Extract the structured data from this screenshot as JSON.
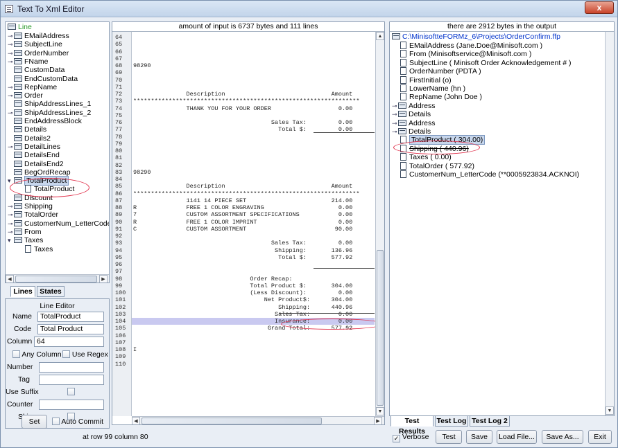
{
  "window": {
    "title": "Text To Xml Editor",
    "close_label": "x"
  },
  "left_tree": {
    "root": "Line",
    "items": [
      {
        "label": "EMailAddress",
        "t": "⊸"
      },
      {
        "label": "SubjectLine",
        "t": "⊸"
      },
      {
        "label": "OrderNumber",
        "t": "⊸"
      },
      {
        "label": "FName",
        "t": "⊸"
      },
      {
        "label": "CustomData",
        "t": ""
      },
      {
        "label": "EndCustomData",
        "t": ""
      },
      {
        "label": "RepName",
        "t": "⊸"
      },
      {
        "label": "Order",
        "t": "⊸"
      },
      {
        "label": "ShipAddressLines_1",
        "t": ""
      },
      {
        "label": "ShipAddressLines_2",
        "t": "⊸"
      },
      {
        "label": "EndAddressBlock",
        "t": ""
      },
      {
        "label": "Details",
        "t": ""
      },
      {
        "label": "Details2",
        "t": ""
      },
      {
        "label": "DetailLines",
        "t": "⊸"
      },
      {
        "label": "DetailsEnd",
        "t": ""
      },
      {
        "label": "DetailsEnd2",
        "t": ""
      },
      {
        "label": "BegOrdRecap",
        "t": ""
      },
      {
        "label": "TotalProduct",
        "t": "▾"
      },
      {
        "label": "TotalProduct",
        "t": "",
        "child": true
      },
      {
        "label": "Discount",
        "t": ""
      },
      {
        "label": "Shipping",
        "t": "⊸"
      },
      {
        "label": "TotalOrder",
        "t": "⊸"
      },
      {
        "label": "CustomerNum_LetterCode",
        "t": "⊸"
      },
      {
        "label": "From",
        "t": "⊸"
      },
      {
        "label": "Taxes",
        "t": "▾"
      },
      {
        "label": "Taxes",
        "t": "",
        "child": true
      }
    ]
  },
  "tabs": {
    "lines": "Lines",
    "states": "States"
  },
  "line_editor": {
    "title": "Line Editor",
    "name_label": "Name",
    "name_value": "TotalProduct",
    "code_label": "Code",
    "code_value": "Total Product",
    "column_label": "Column",
    "column_value": "64",
    "any_column": "Any Column",
    "use_regex": "Use Regex",
    "number_label": "Number",
    "number_value": "",
    "tag_label": "Tag",
    "tag_value": "",
    "use_suffix": "Use Suffix",
    "counter_label": "Counter",
    "counter_value": "",
    "skip_label": "Skip",
    "set_button": "Set",
    "auto_commit": "Auto Commit"
  },
  "center": {
    "header": "amount of input is 6737 bytes and 111 lines",
    "lines": [
      {
        "n": "64",
        "t": ""
      },
      {
        "n": "65",
        "t": ""
      },
      {
        "n": "66",
        "t": ""
      },
      {
        "n": "67",
        "t": ""
      },
      {
        "n": "68",
        "t": "98290"
      },
      {
        "n": "69",
        "t": ""
      },
      {
        "n": "70",
        "t": ""
      },
      {
        "n": "71",
        "t": ""
      },
      {
        "n": "72",
        "t": "               Description                              Amount"
      },
      {
        "n": "73",
        "t": "****************************************************************"
      },
      {
        "n": "74",
        "t": "               THANK YOU FOR YOUR ORDER                   0.00"
      },
      {
        "n": "75",
        "t": ""
      },
      {
        "n": "76",
        "t": "                                       Sales Tax:         0.00"
      },
      {
        "n": "77",
        "t": "                                         Total $:         0.00"
      },
      {
        "n": "78",
        "t": ""
      },
      {
        "n": "79",
        "t": ""
      },
      {
        "n": "80",
        "t": ""
      },
      {
        "n": "81",
        "t": ""
      },
      {
        "n": "82",
        "t": ""
      },
      {
        "n": "83",
        "t": "98290"
      },
      {
        "n": "84",
        "t": ""
      },
      {
        "n": "85",
        "t": "               Description                              Amount"
      },
      {
        "n": "86",
        "t": "****************************************************************"
      },
      {
        "n": "87",
        "t": "               1141 14 PIECE SET                        214.00"
      },
      {
        "n": "88",
        "t": "R              FREE 1 COLOR ENGRAVING                     0.00"
      },
      {
        "n": "89",
        "t": "7              CUSTOM ASSORTMENT SPECIFICATIONS           0.00"
      },
      {
        "n": "90",
        "t": "R              FREE 1 COLOR IMPRINT                       0.00"
      },
      {
        "n": "91",
        "t": "C              CUSTOM ASSORTMENT                         90.00"
      },
      {
        "n": "92",
        "t": ""
      },
      {
        "n": "93",
        "t": "                                       Sales Tax:         0.00"
      },
      {
        "n": "94",
        "t": "                                        Shipping:       136.96"
      },
      {
        "n": "95",
        "t": "                                         Total $:       577.92"
      },
      {
        "n": "96",
        "t": ""
      },
      {
        "n": "97",
        "t": ""
      },
      {
        "n": "98",
        "t": "                                 Order Recap:"
      },
      {
        "n": "99",
        "t": "                                 Total Product $:       304.00"
      },
      {
        "n": "100",
        "t": "                                 (Less Discount):         0.00"
      },
      {
        "n": "101",
        "t": "                                     Net Product$:      304.00"
      },
      {
        "n": "102",
        "t": "                                         Shipping:      440.96"
      },
      {
        "n": "103",
        "t": "                                        Sales Tax:        0.00"
      },
      {
        "n": "104",
        "t": "                                        Insurance:        0.00"
      },
      {
        "n": "105",
        "t": "                                      Grand Total:      577.92"
      },
      {
        "n": "106",
        "t": ""
      },
      {
        "n": "107",
        "t": ""
      },
      {
        "n": "108",
        "t": "I"
      },
      {
        "n": "109",
        "t": ""
      },
      {
        "n": "110",
        "t": ""
      }
    ]
  },
  "right": {
    "header": "there are 2912 bytes in the output",
    "root": "C:\\MinisoftteFORMz_6\\Projects\\OrderConfirm.ffp",
    "items": [
      {
        "label": "EMailAddress (Jane.Doe@Minisoft.com      )",
        "kind": "doc"
      },
      {
        "label": "From (Minisoftservice@Minisoft.com      )",
        "kind": "doc"
      },
      {
        "label": "SubjectLine ( Minisoft Order Acknowledgement #       )",
        "kind": "doc"
      },
      {
        "label": "OrderNumber (PDTA  )",
        "kind": "doc"
      },
      {
        "label": "FirstInitial (o)",
        "kind": "doc"
      },
      {
        "label": "LowerName (hn      )",
        "kind": "doc"
      },
      {
        "label": "RepName (John Doe      )",
        "kind": "doc"
      },
      {
        "label": "Address",
        "kind": "folder"
      },
      {
        "label": "Details",
        "kind": "folder"
      },
      {
        "label": "Address",
        "kind": "folder"
      },
      {
        "label": "Details",
        "kind": "folder"
      },
      {
        "label": "TotalProduct (   304.00)",
        "kind": "doc"
      },
      {
        "label": "Shipping (   440.96)",
        "kind": "doc"
      },
      {
        "label": "Taxes (    0.00)",
        "kind": "doc"
      },
      {
        "label": "TotalOrder (  577.92)",
        "kind": "doc"
      },
      {
        "label": "CustomerNum_LetterCode (**0005923834.ACKNOI)",
        "kind": "doc"
      }
    ],
    "tabs": [
      "Test Results",
      "Test Log",
      "Test Log 2"
    ]
  },
  "bottom": {
    "status": "at row 99 column 80",
    "verbose": "Verbose",
    "buttons": [
      "Test",
      "Save",
      "Load File...",
      "Save As...",
      "Exit"
    ]
  }
}
